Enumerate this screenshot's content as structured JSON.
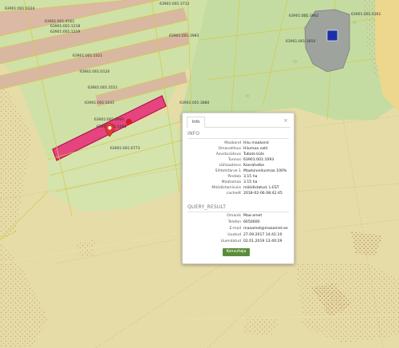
{
  "parcel_labels": [
    "63901:001:0324",
    "63901:001:4561",
    "63901:001:1218",
    "63901:001:1219",
    "63901:001:3712",
    "63901:001:3962",
    "63901:001:0361",
    "63901:001:3983",
    "63901:001:3850",
    "63901:001:1021",
    "63901:001:0120",
    "63901:001:3551",
    "63901:001:1031",
    "63901:001:3880",
    "63901:001:3960",
    "63901:001:1093",
    "63901:001:0773"
  ],
  "popup": {
    "tab_label": "Info",
    "close_glyph": "×",
    "info_title": "INFO",
    "info_rows": [
      {
        "key": "Maakond",
        "value": "Hiiu maakond"
      },
      {
        "key": "Omavalitsus",
        "value": "Hiiumaa vald"
      },
      {
        "key": "Asustusüksus",
        "value": "Tubala küla"
      },
      {
        "key": "Tunnus",
        "value": "63901:001:1093"
      },
      {
        "key": "Lähiaadress",
        "value": "Kaerahelbe"
      },
      {
        "key": "Sihtotstarve 1",
        "value": "Maatulundusmaa 100%"
      },
      {
        "key": "Pindala",
        "value": "3.15 ha"
      },
      {
        "key": "Maatamaa",
        "value": "3.15 ha"
      },
      {
        "key": "Mõõdistamisviis",
        "value": "mõõdistatud, L-EST"
      },
      {
        "key": "cachedt",
        "value": "2018-02-06 08:42:45"
      }
    ],
    "query_title": "QUERY_RESULT",
    "query_rows": [
      {
        "key": "Omanik",
        "value": "Maa-amet"
      },
      {
        "key": "Telefon",
        "value": "6650600"
      },
      {
        "key": "E-mail",
        "value": "maaamet@maaamet.ee"
      },
      {
        "key": "Uuatud",
        "value": "27.09.2017 14:41:10"
      },
      {
        "key": "Uuendatud",
        "value": "02.01.2019 13:40:29"
      }
    ],
    "button_label": "Konsultaja"
  },
  "colors": {
    "base": "#e6dca8",
    "parcel_band": "#d9b8a2",
    "selected_parcel": "#e0357a",
    "green_area": "#c8dfa3",
    "marker": "#e23b2e",
    "marker_small": "#d51d1d",
    "blue_square": "#1d2fa8",
    "button": "#5a8d3b"
  },
  "icons": {
    "marker": "map-pin-icon",
    "close": "close-icon"
  }
}
